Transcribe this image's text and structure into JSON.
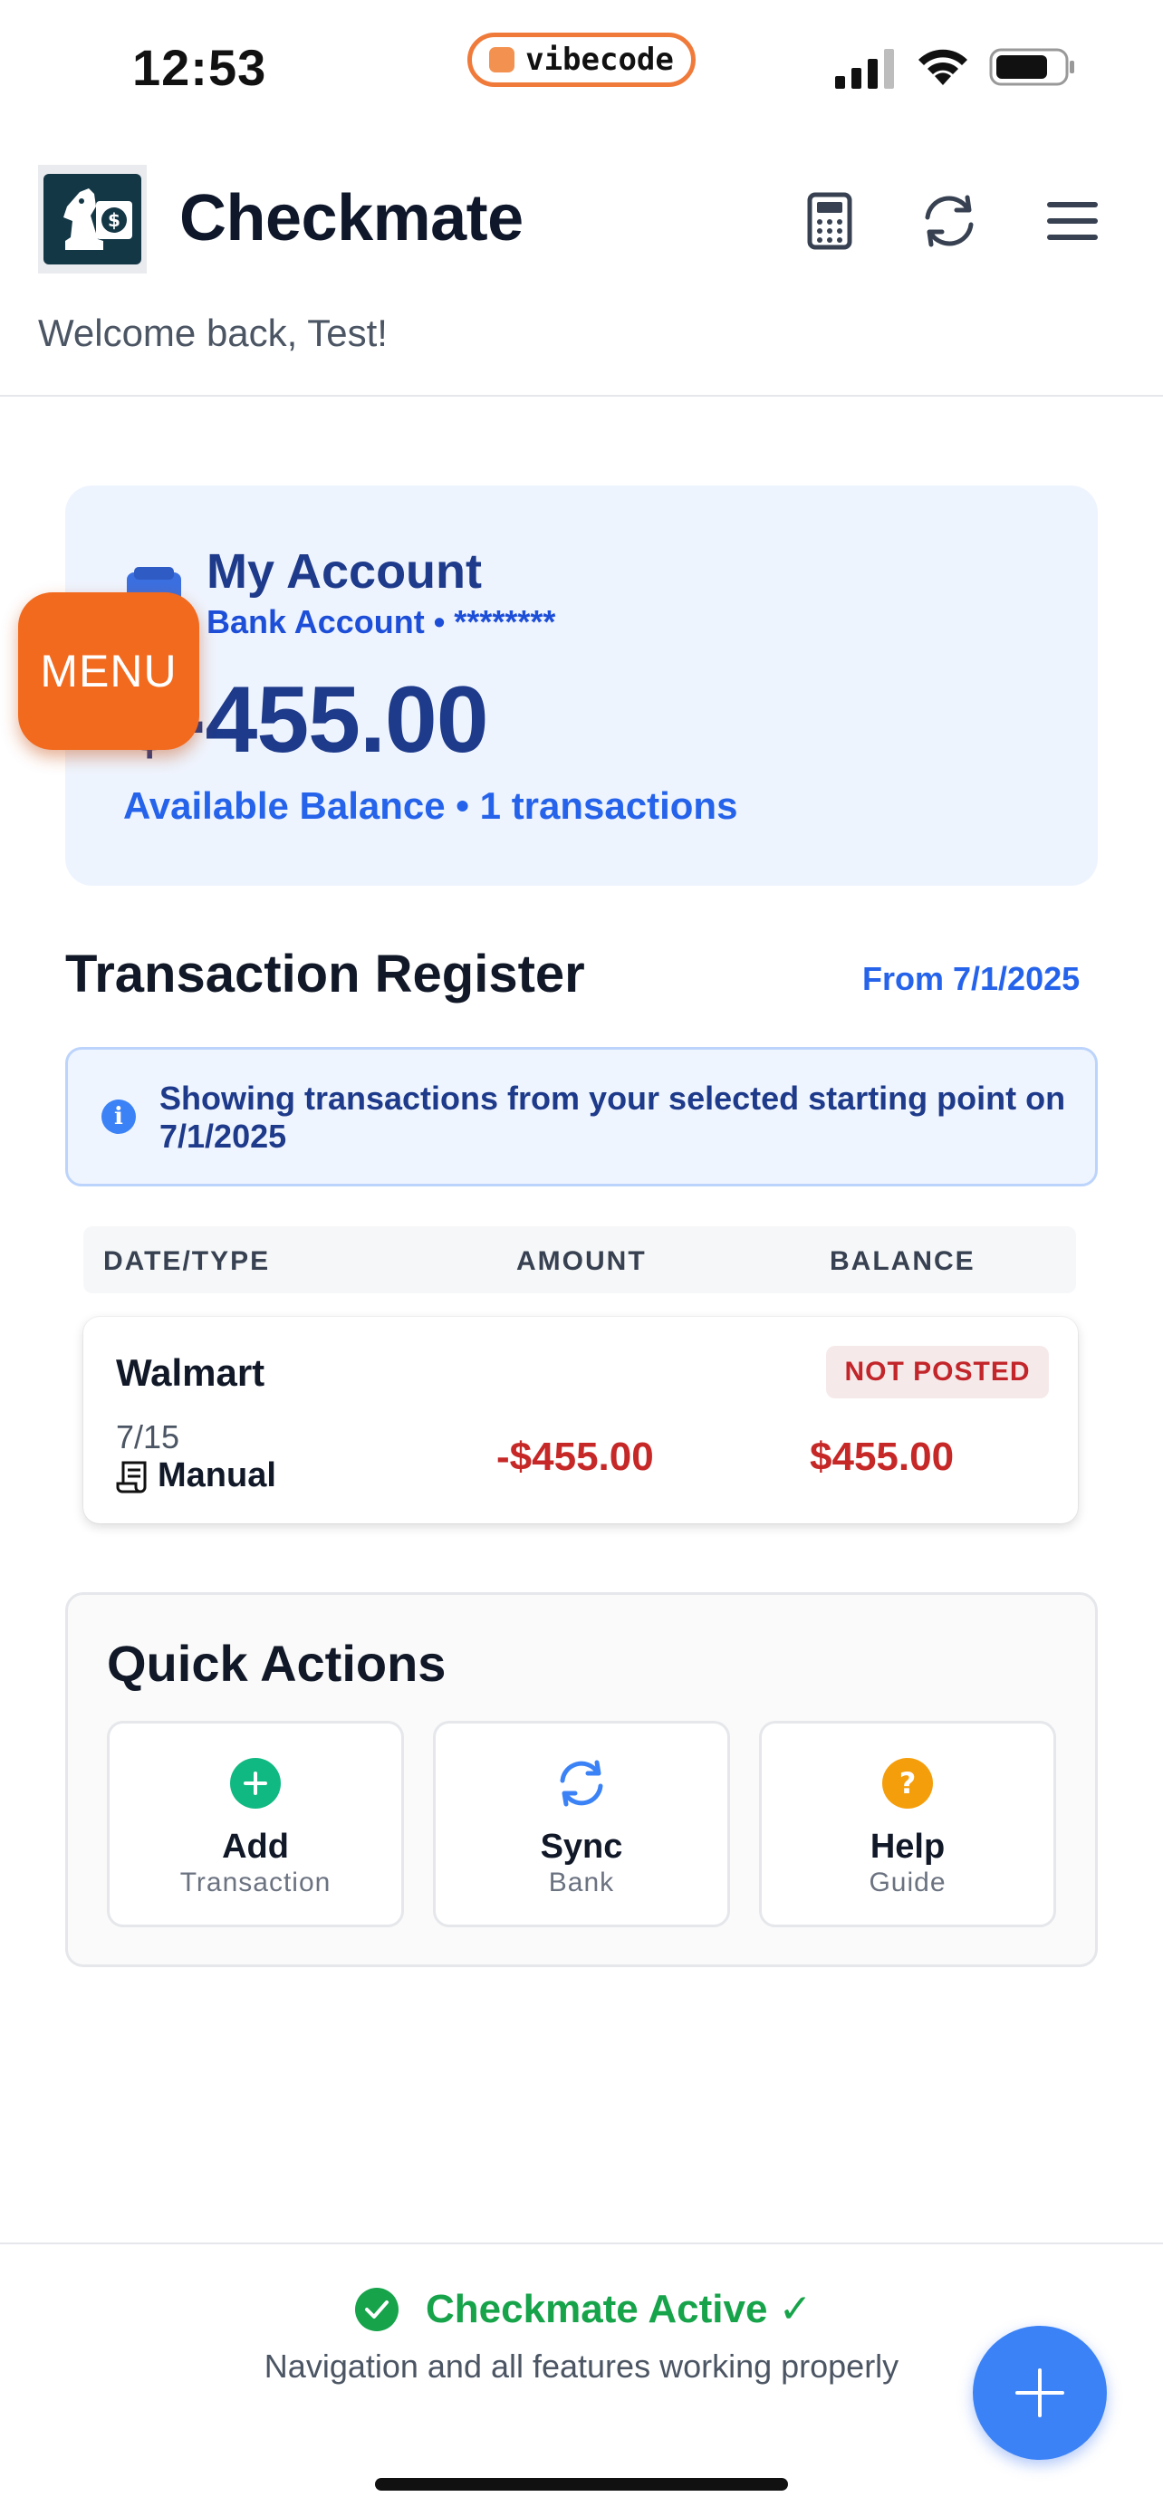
{
  "status_bar": {
    "time": "12:53",
    "center_pill": "vibecode"
  },
  "header": {
    "app_title": "Checkmate",
    "welcome": "Welcome back, Test!",
    "icons": [
      "calculator-icon",
      "refresh-icon",
      "hamburger-menu-icon"
    ]
  },
  "floating_menu": {
    "label": "MENU"
  },
  "account": {
    "title": "My Account",
    "subtitle": "Bank Account • ********",
    "balance": "$-455.00",
    "summary": "Available Balance • 1 transactions"
  },
  "register": {
    "title": "Transaction Register",
    "from_label": "From 7/1/2025",
    "info": "Showing transactions from your selected starting point on 7/1/2025",
    "columns": [
      "DATE/TYPE",
      "AMOUNT",
      "BALANCE"
    ],
    "transactions": [
      {
        "name": "Walmart",
        "status": "NOT POSTED",
        "date": "7/15",
        "type": "Manual",
        "amount": "-$455.00",
        "balance": "$455.00"
      }
    ]
  },
  "quick_actions": {
    "title": "Quick Actions",
    "items": [
      {
        "main": "Add",
        "sub": "Transaction",
        "icon": "plus-circle-icon"
      },
      {
        "main": "Sync",
        "sub": "Bank",
        "icon": "sync-icon"
      },
      {
        "main": "Help",
        "sub": "Guide",
        "icon": "help-circle-icon"
      }
    ]
  },
  "footer": {
    "status": "Checkmate Active ✓",
    "status_sub": "Navigation and all features working properly"
  },
  "colors": {
    "brand_blue": "#2563eb",
    "menu_orange": "#f26a1e",
    "negative_red": "#c62828",
    "success_green": "#16a34a"
  }
}
